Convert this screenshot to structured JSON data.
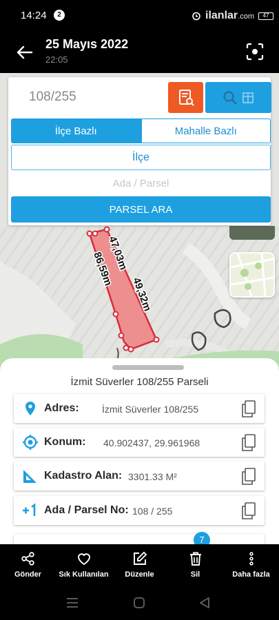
{
  "status_bar": {
    "time": "14:24",
    "notification_count": "2",
    "watermark": "ilanlar",
    "watermark_suffix": ".com",
    "battery": "47"
  },
  "header": {
    "title": "25 Mayıs 2022",
    "subtitle": "22:05",
    "back_icon": "arrow-left-icon",
    "action_icon": "focus-target-icon"
  },
  "search": {
    "parcel_value": "108/255",
    "report_icon": "document-search-icon",
    "search_icon": "magnifier-icon",
    "tabs": [
      {
        "label": "İlçe Bazlı",
        "active": true
      },
      {
        "label": "Mahalle Bazlı",
        "active": false
      }
    ],
    "district_label": "İlçe",
    "ada_placeholder": "Ada / Parsel",
    "search_button": "PARSEL ARA"
  },
  "map": {
    "dimension_labels": [
      "47,03m",
      "49,32m",
      "86,59m"
    ],
    "parcel_color": "#f08080",
    "parcel_stroke": "#d62d3a"
  },
  "parcel_info": {
    "title": "İzmit Süverler 108/255 Parseli",
    "rows": [
      {
        "icon": "location-pin-icon",
        "label": "Adres:",
        "value": "İzmit Süverler 108/255"
      },
      {
        "icon": "crosshair-icon",
        "label": "Konum:",
        "value": "40.902437, 29.961968"
      },
      {
        "icon": "ruler-triangle-icon",
        "label": "Kadastro Alan:",
        "value": "3301.33 M²"
      },
      {
        "icon": "plus-one-icon",
        "label": "Ada / Parsel No:",
        "value": "108 / 255"
      }
    ],
    "badge": "7",
    "accent": "#1e9fe0"
  },
  "toolbar": {
    "items": [
      {
        "icon": "share-icon",
        "label": "Gönder"
      },
      {
        "icon": "heart-icon",
        "label": "Sık Kullanılan"
      },
      {
        "icon": "edit-icon",
        "label": "Düzenle"
      },
      {
        "icon": "trash-icon",
        "label": "Sil"
      },
      {
        "icon": "more-vertical-icon",
        "label": "Daha fazla"
      }
    ]
  }
}
